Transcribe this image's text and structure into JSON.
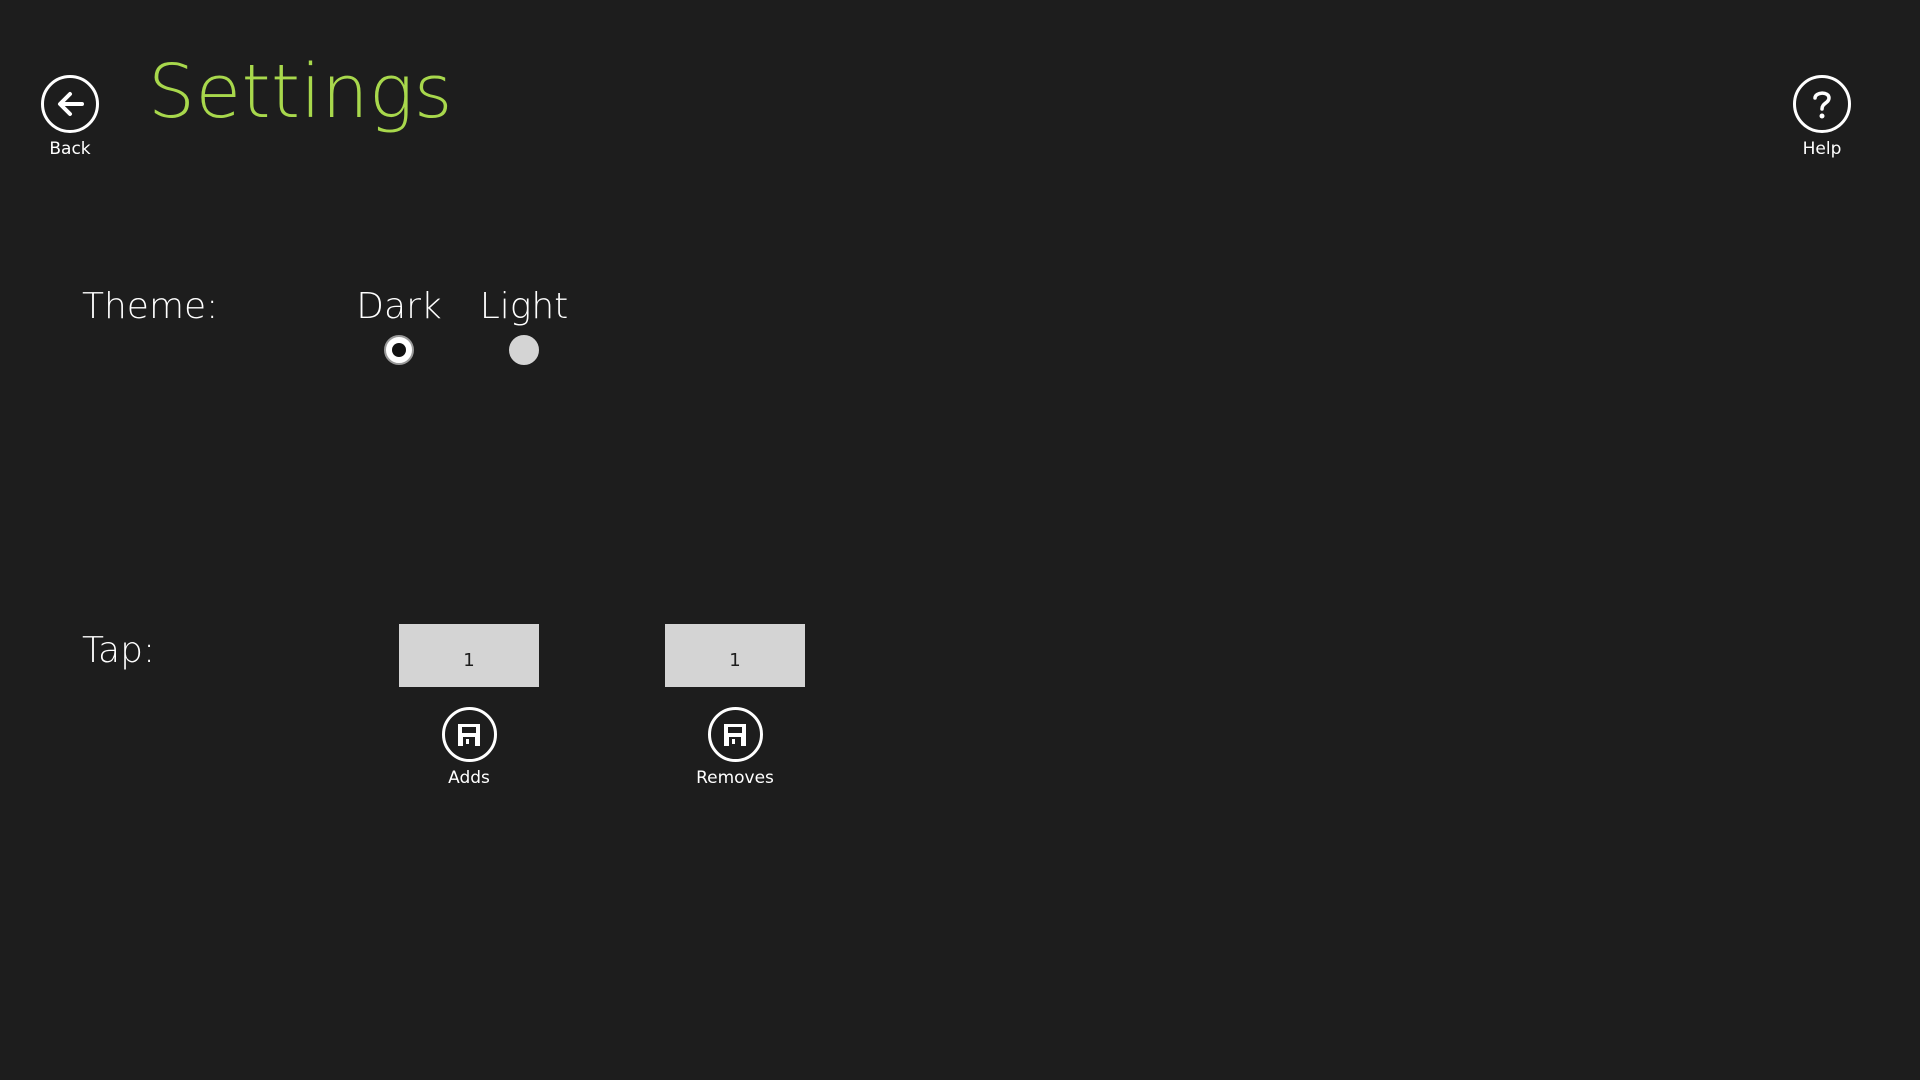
{
  "header": {
    "title": "Settings",
    "back_label": "Back",
    "help_label": "Help",
    "back_icon": "arrow-left-icon",
    "help_icon": "question-mark-icon"
  },
  "theme": {
    "label": "Theme:",
    "options": [
      {
        "label": "Dark",
        "checked": true
      },
      {
        "label": "Light",
        "checked": false
      }
    ]
  },
  "tap": {
    "label": "Tap:",
    "adds_value": "1",
    "removes_value": "1",
    "adds_label": "Adds",
    "removes_label": "Removes",
    "save_icon": "floppy-disk-icon"
  },
  "colors": {
    "background": "#1d1d1d",
    "accent": "#a8d84c",
    "input_fill": "#d4d4d4"
  }
}
